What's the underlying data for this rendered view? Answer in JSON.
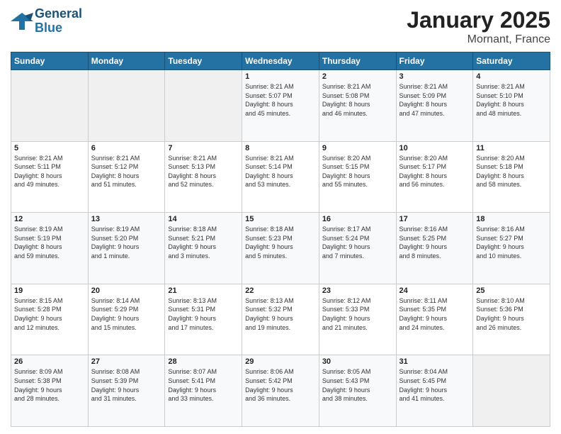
{
  "header": {
    "logo_general": "General",
    "logo_blue": "Blue",
    "title": "January 2025",
    "subtitle": "Mornant, France"
  },
  "weekdays": [
    "Sunday",
    "Monday",
    "Tuesday",
    "Wednesday",
    "Thursday",
    "Friday",
    "Saturday"
  ],
  "weeks": [
    [
      {
        "day": "",
        "info": ""
      },
      {
        "day": "",
        "info": ""
      },
      {
        "day": "",
        "info": ""
      },
      {
        "day": "1",
        "info": "Sunrise: 8:21 AM\nSunset: 5:07 PM\nDaylight: 8 hours\nand 45 minutes."
      },
      {
        "day": "2",
        "info": "Sunrise: 8:21 AM\nSunset: 5:08 PM\nDaylight: 8 hours\nand 46 minutes."
      },
      {
        "day": "3",
        "info": "Sunrise: 8:21 AM\nSunset: 5:09 PM\nDaylight: 8 hours\nand 47 minutes."
      },
      {
        "day": "4",
        "info": "Sunrise: 8:21 AM\nSunset: 5:10 PM\nDaylight: 8 hours\nand 48 minutes."
      }
    ],
    [
      {
        "day": "5",
        "info": "Sunrise: 8:21 AM\nSunset: 5:11 PM\nDaylight: 8 hours\nand 49 minutes."
      },
      {
        "day": "6",
        "info": "Sunrise: 8:21 AM\nSunset: 5:12 PM\nDaylight: 8 hours\nand 51 minutes."
      },
      {
        "day": "7",
        "info": "Sunrise: 8:21 AM\nSunset: 5:13 PM\nDaylight: 8 hours\nand 52 minutes."
      },
      {
        "day": "8",
        "info": "Sunrise: 8:21 AM\nSunset: 5:14 PM\nDaylight: 8 hours\nand 53 minutes."
      },
      {
        "day": "9",
        "info": "Sunrise: 8:20 AM\nSunset: 5:15 PM\nDaylight: 8 hours\nand 55 minutes."
      },
      {
        "day": "10",
        "info": "Sunrise: 8:20 AM\nSunset: 5:17 PM\nDaylight: 8 hours\nand 56 minutes."
      },
      {
        "day": "11",
        "info": "Sunrise: 8:20 AM\nSunset: 5:18 PM\nDaylight: 8 hours\nand 58 minutes."
      }
    ],
    [
      {
        "day": "12",
        "info": "Sunrise: 8:19 AM\nSunset: 5:19 PM\nDaylight: 8 hours\nand 59 minutes."
      },
      {
        "day": "13",
        "info": "Sunrise: 8:19 AM\nSunset: 5:20 PM\nDaylight: 9 hours\nand 1 minute."
      },
      {
        "day": "14",
        "info": "Sunrise: 8:18 AM\nSunset: 5:21 PM\nDaylight: 9 hours\nand 3 minutes."
      },
      {
        "day": "15",
        "info": "Sunrise: 8:18 AM\nSunset: 5:23 PM\nDaylight: 9 hours\nand 5 minutes."
      },
      {
        "day": "16",
        "info": "Sunrise: 8:17 AM\nSunset: 5:24 PM\nDaylight: 9 hours\nand 7 minutes."
      },
      {
        "day": "17",
        "info": "Sunrise: 8:16 AM\nSunset: 5:25 PM\nDaylight: 9 hours\nand 8 minutes."
      },
      {
        "day": "18",
        "info": "Sunrise: 8:16 AM\nSunset: 5:27 PM\nDaylight: 9 hours\nand 10 minutes."
      }
    ],
    [
      {
        "day": "19",
        "info": "Sunrise: 8:15 AM\nSunset: 5:28 PM\nDaylight: 9 hours\nand 12 minutes."
      },
      {
        "day": "20",
        "info": "Sunrise: 8:14 AM\nSunset: 5:29 PM\nDaylight: 9 hours\nand 15 minutes."
      },
      {
        "day": "21",
        "info": "Sunrise: 8:13 AM\nSunset: 5:31 PM\nDaylight: 9 hours\nand 17 minutes."
      },
      {
        "day": "22",
        "info": "Sunrise: 8:13 AM\nSunset: 5:32 PM\nDaylight: 9 hours\nand 19 minutes."
      },
      {
        "day": "23",
        "info": "Sunrise: 8:12 AM\nSunset: 5:33 PM\nDaylight: 9 hours\nand 21 minutes."
      },
      {
        "day": "24",
        "info": "Sunrise: 8:11 AM\nSunset: 5:35 PM\nDaylight: 9 hours\nand 24 minutes."
      },
      {
        "day": "25",
        "info": "Sunrise: 8:10 AM\nSunset: 5:36 PM\nDaylight: 9 hours\nand 26 minutes."
      }
    ],
    [
      {
        "day": "26",
        "info": "Sunrise: 8:09 AM\nSunset: 5:38 PM\nDaylight: 9 hours\nand 28 minutes."
      },
      {
        "day": "27",
        "info": "Sunrise: 8:08 AM\nSunset: 5:39 PM\nDaylight: 9 hours\nand 31 minutes."
      },
      {
        "day": "28",
        "info": "Sunrise: 8:07 AM\nSunset: 5:41 PM\nDaylight: 9 hours\nand 33 minutes."
      },
      {
        "day": "29",
        "info": "Sunrise: 8:06 AM\nSunset: 5:42 PM\nDaylight: 9 hours\nand 36 minutes."
      },
      {
        "day": "30",
        "info": "Sunrise: 8:05 AM\nSunset: 5:43 PM\nDaylight: 9 hours\nand 38 minutes."
      },
      {
        "day": "31",
        "info": "Sunrise: 8:04 AM\nSunset: 5:45 PM\nDaylight: 9 hours\nand 41 minutes."
      },
      {
        "day": "",
        "info": ""
      }
    ]
  ]
}
